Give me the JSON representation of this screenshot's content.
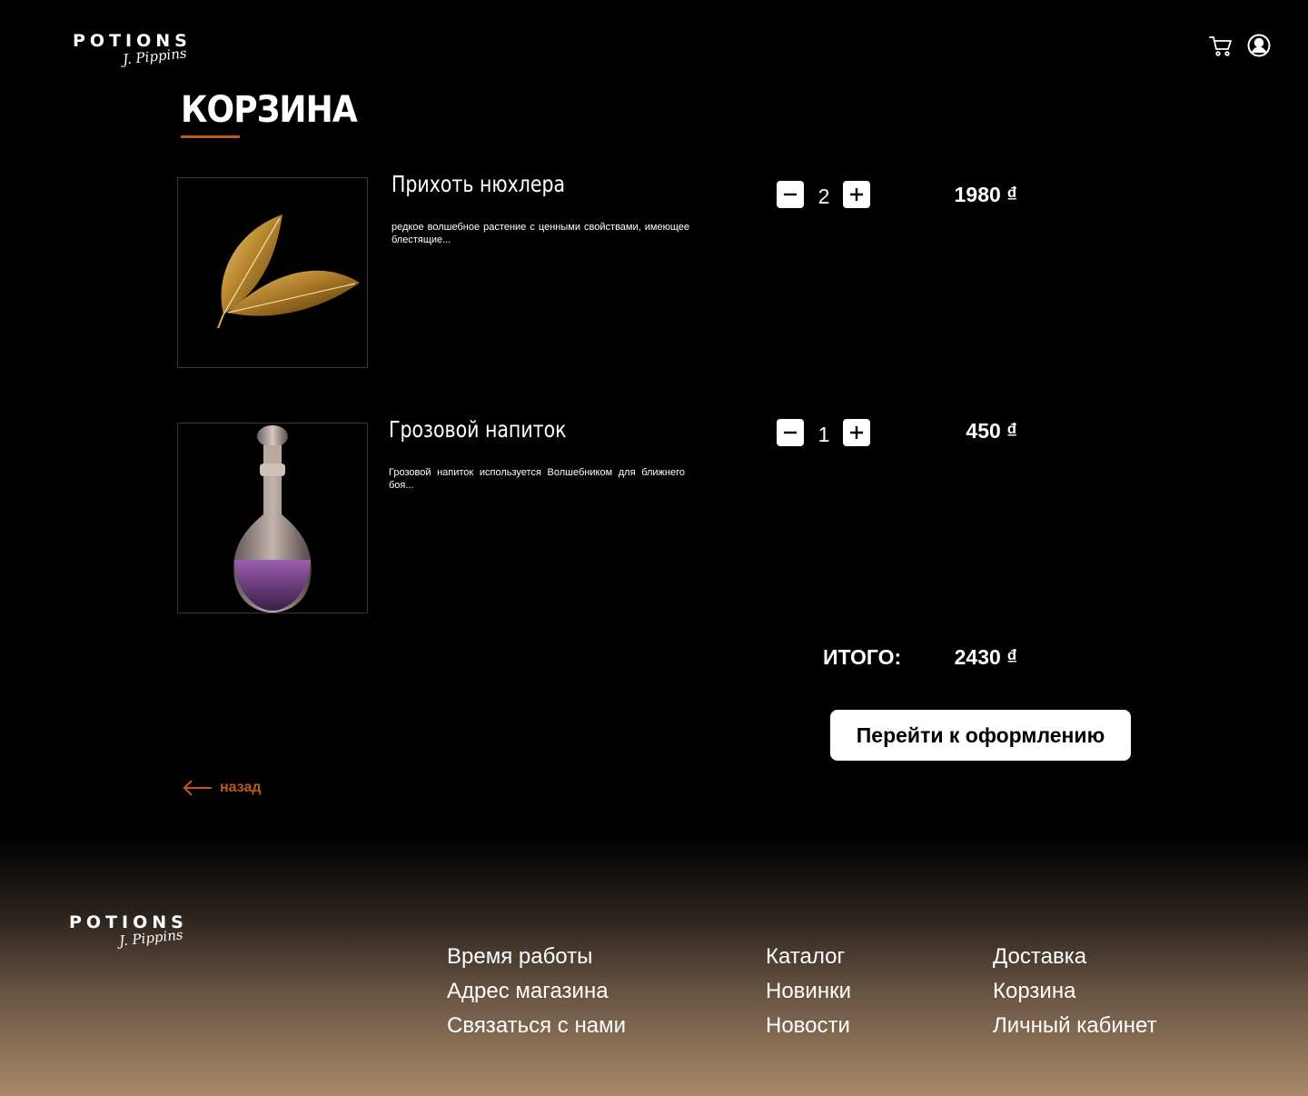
{
  "header": {
    "logo_word": "POTIONS",
    "logo_script": "J. Pippins"
  },
  "page": {
    "title": "КОРЗИНА"
  },
  "cart": {
    "items": [
      {
        "name": "Прихоть нюхлера",
        "description": "редкое волшебное растение с ценными свойствами, имеющее блестящие...",
        "quantity": "2",
        "price": "1980 ₫"
      },
      {
        "name": "Грозовой напиток",
        "description": "Грозовой напиток используется Волшебником для ближнего боя...",
        "quantity": "1",
        "price": "450 ₫"
      }
    ],
    "total_label": "ИТОГО:",
    "total_value": "2430 ₫",
    "checkout_label": "Перейти к оформлению",
    "back_label": "назад"
  },
  "footer": {
    "logo_word": "POTIONS",
    "logo_script": "J. Pippins",
    "columns": [
      [
        "Время работы",
        "Адрес магазина",
        "Связаться с нами"
      ],
      [
        "Каталог",
        "Новинки",
        "Новости"
      ],
      [
        "Доставка",
        "Корзина",
        "Личный кабинет"
      ]
    ]
  },
  "colors": {
    "background": "#000000",
    "accent": "#c2561c",
    "footer_gradient_end": "#a8896a"
  },
  "icons": [
    "cart-icon",
    "user-icon",
    "minus-icon",
    "plus-icon",
    "arrow-left-icon"
  ]
}
